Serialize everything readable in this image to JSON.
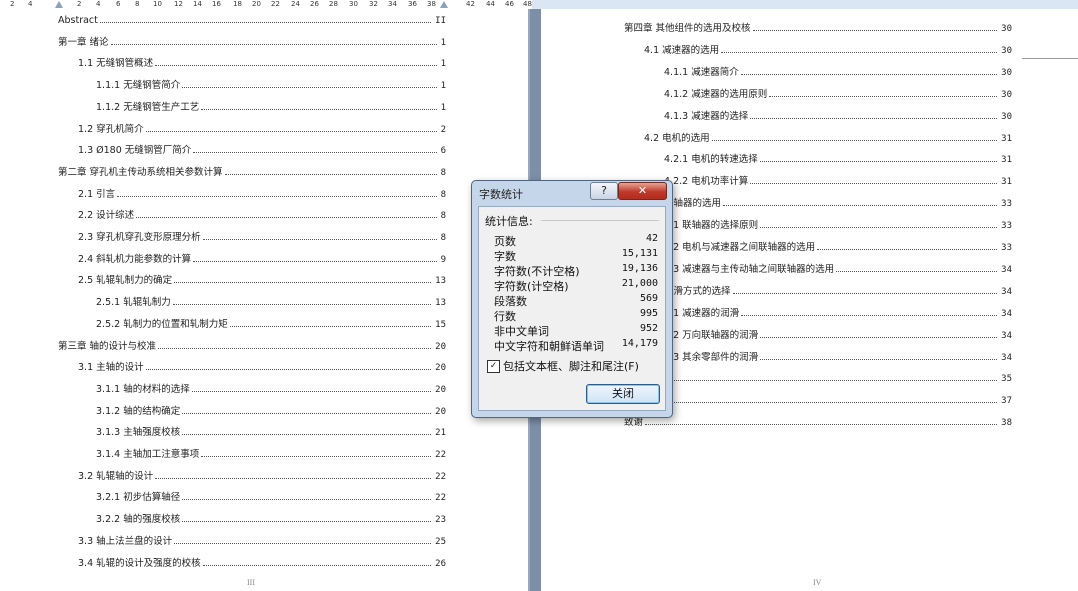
{
  "ruler": {
    "numbers": [
      "2",
      "4",
      "2",
      "4",
      "6",
      "8",
      "10",
      "12",
      "14",
      "16",
      "18",
      "20",
      "22",
      "24",
      "26",
      "28",
      "30",
      "32",
      "34",
      "36",
      "38",
      "42",
      "44",
      "46",
      "48"
    ]
  },
  "left_page": {
    "footer": "III",
    "entries": [
      {
        "text": "Abstract",
        "page": "II"
      },
      {
        "text": "第一章   绪论",
        "page": "1"
      },
      {
        "text": "1.1 无缝钢管概述",
        "page": "1"
      },
      {
        "text": "1.1.1 无缝钢管简介",
        "page": "1"
      },
      {
        "text": "1.1.2 无缝钢管生产工艺",
        "page": "1"
      },
      {
        "text": "1.2 穿孔机简介",
        "page": "2"
      },
      {
        "text": "1.3 Ø180 无缝钢管厂简介",
        "page": "6"
      },
      {
        "text": "第二章  穿孔机主传动系统相关参数计算",
        "page": "8"
      },
      {
        "text": "2.1 引言",
        "page": "8"
      },
      {
        "text": "2.2 设计综述",
        "page": "8"
      },
      {
        "text": "2.3 穿孔机穿孔变形原理分析",
        "page": "8"
      },
      {
        "text": "2.4 斜轧机力能参数的计算",
        "page": "9"
      },
      {
        "text": "2.5 轧辊轧制力的确定",
        "page": "13"
      },
      {
        "text": "2.5.1 轧辊轧制力",
        "page": "13"
      },
      {
        "text": "2.5.2 轧制力的位置和轧制力矩",
        "page": "15"
      },
      {
        "text": "第三章   轴的设计与校准",
        "page": "20"
      },
      {
        "text": "3.1 主轴的设计",
        "page": "20"
      },
      {
        "text": "3.1.1 轴的材料的选择",
        "page": "20"
      },
      {
        "text": "3.1.2 轴的结构确定",
        "page": "20"
      },
      {
        "text": "3.1.3 主轴强度校核",
        "page": "21"
      },
      {
        "text": "3.1.4 主轴加工注意事项",
        "page": "22"
      },
      {
        "text": "3.2 轧辊轴的设计",
        "page": "22"
      },
      {
        "text": "3.2.1 初步估算轴径",
        "page": "22"
      },
      {
        "text": "3.2.2 轴的强度校核",
        "page": "23"
      },
      {
        "text": "3.3 轴上法兰盘的设计",
        "page": "25"
      },
      {
        "text": "3.4 轧辊的设计及强度的校核",
        "page": "26"
      }
    ]
  },
  "right_page": {
    "footer": "IV",
    "entries": [
      {
        "text": "第四章   其他组件的选用及校核",
        "page": "30"
      },
      {
        "text": "4.1   减速器的选用",
        "page": "30"
      },
      {
        "text": "4.1.1 减速器简介",
        "page": "30"
      },
      {
        "text": "4.1.2 减速器的选用原则",
        "page": "30"
      },
      {
        "text": "4.1.3 减速器的选择",
        "page": "30"
      },
      {
        "text": "4.2 电机的选用",
        "page": "31"
      },
      {
        "text": "4.2.1 电机的转速选择",
        "page": "31"
      },
      {
        "text": "4.2.2 电机功率计算",
        "page": "31"
      },
      {
        "text": "联轴器的选用",
        "page": "33"
      },
      {
        "text": "3.1 联轴器的选择原则",
        "page": "33"
      },
      {
        "text": "3.2 电机与减速器之间联轴器的选用",
        "page": "33"
      },
      {
        "text": "3.3 减速器与主传动轴之间联轴器的选用",
        "page": "34"
      },
      {
        "text": "润滑方式的选择",
        "page": "34"
      },
      {
        "text": "4.1 减速器的润滑",
        "page": "34"
      },
      {
        "text": "4.2 万向联轴器的润滑",
        "page": "34"
      },
      {
        "text": "4.3 其余零部件的润滑",
        "page": "34"
      },
      {
        "text": "",
        "page": "35"
      },
      {
        "text": "",
        "page": "37"
      },
      {
        "text": "致谢",
        "page": "38"
      }
    ]
  },
  "dialog": {
    "title": "字数统计",
    "help_label": "?",
    "close_x_label": "✕",
    "section_label": "统计信息:",
    "stats": [
      {
        "label": "页数",
        "value": "42"
      },
      {
        "label": "字数",
        "value": "15,131"
      },
      {
        "label": "字符数(不计空格)",
        "value": "19,136"
      },
      {
        "label": "字符数(计空格)",
        "value": "21,000"
      },
      {
        "label": "段落数",
        "value": "569"
      },
      {
        "label": "行数",
        "value": "995"
      },
      {
        "label": "非中文单词",
        "value": "952"
      },
      {
        "label": "中文字符和朝鲜语单词",
        "value": "14,179"
      }
    ],
    "checkbox_label": "包括文本框、脚注和尾注(F)",
    "checkbox_checked": "✓",
    "close_button": "关闭"
  }
}
